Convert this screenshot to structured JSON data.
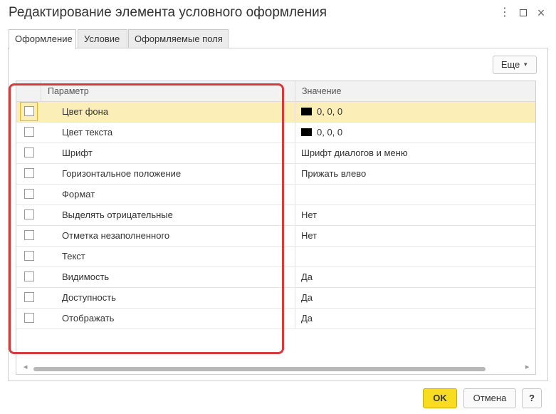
{
  "window": {
    "title": "Редактирование элемента условного оформления",
    "more_glyph": "⋮",
    "close_glyph": "×"
  },
  "tabs": [
    {
      "label": "Оформление",
      "active": true
    },
    {
      "label": "Условие",
      "active": false
    },
    {
      "label": "Оформляемые поля",
      "active": false
    }
  ],
  "toolbar": {
    "more_label": "Еще",
    "more_caret": "▼"
  },
  "table": {
    "headers": {
      "param": "Параметр",
      "value": "Значение"
    },
    "rows": [
      {
        "name": "Цвет фона",
        "value": "0, 0, 0",
        "swatch": "#000000",
        "checked": false,
        "selected": true
      },
      {
        "name": "Цвет текста",
        "value": "0, 0, 0",
        "swatch": "#000000",
        "checked": false,
        "selected": false
      },
      {
        "name": "Шрифт",
        "value": "Шрифт диалогов и меню",
        "checked": false,
        "selected": false
      },
      {
        "name": "Горизонтальное положение",
        "value": "Прижать влево",
        "checked": false,
        "selected": false
      },
      {
        "name": "Формат",
        "value": "",
        "checked": false,
        "selected": false
      },
      {
        "name": "Выделять отрицательные",
        "value": "Нет",
        "checked": false,
        "selected": false
      },
      {
        "name": "Отметка незаполненного",
        "value": "Нет",
        "checked": false,
        "selected": false
      },
      {
        "name": "Текст",
        "value": "",
        "checked": false,
        "selected": false
      },
      {
        "name": "Видимость",
        "value": "Да",
        "checked": false,
        "selected": false
      },
      {
        "name": "Доступность",
        "value": "Да",
        "checked": false,
        "selected": false
      },
      {
        "name": "Отображать",
        "value": "Да",
        "checked": false,
        "selected": false
      }
    ],
    "scroll_left_glyph": "◀",
    "scroll_right_glyph": "▶"
  },
  "buttons": {
    "ok": "OK",
    "cancel": "Отмена",
    "help": "?"
  },
  "colors": {
    "ok_button": "#f7dc1f",
    "selected_row": "#fbeeb7",
    "highlight_frame": "#d63a3a"
  }
}
